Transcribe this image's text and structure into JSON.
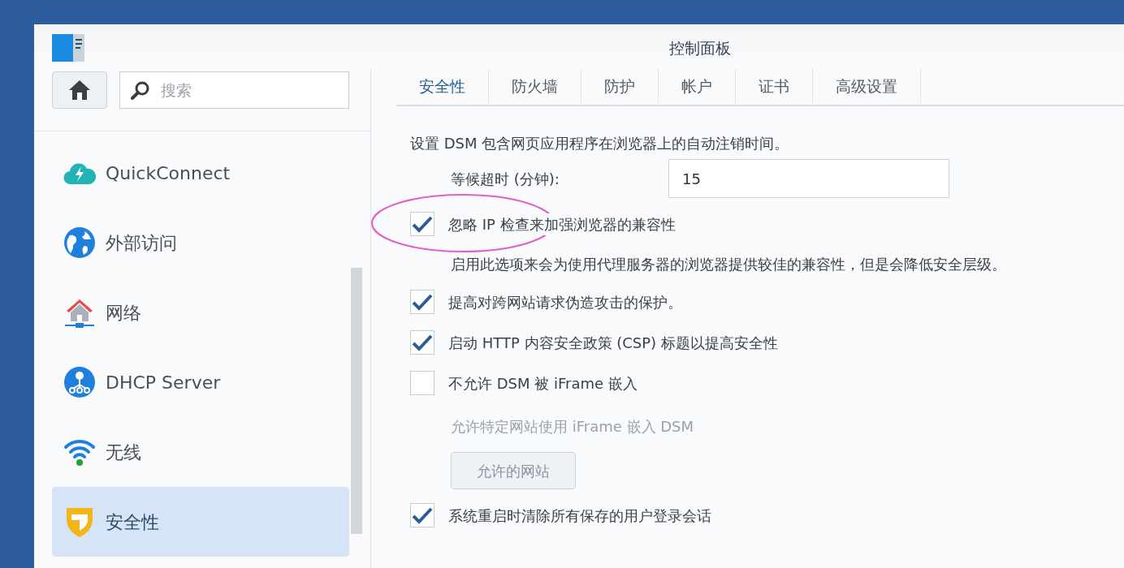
{
  "window": {
    "title": "控制面板"
  },
  "sidebar": {
    "search": {
      "placeholder": "搜索"
    },
    "items": [
      {
        "label": "QuickConnect",
        "selected": false
      },
      {
        "label": "外部访问",
        "selected": false
      },
      {
        "label": "网络",
        "selected": false
      },
      {
        "label": "DHCP Server",
        "selected": false
      },
      {
        "label": "无线",
        "selected": false
      },
      {
        "label": "安全性",
        "selected": true
      }
    ]
  },
  "tabs": [
    {
      "label": "安全性",
      "selected": true
    },
    {
      "label": "防火墙",
      "selected": false
    },
    {
      "label": "防护",
      "selected": false
    },
    {
      "label": "帐户",
      "selected": false
    },
    {
      "label": "证书",
      "selected": false
    },
    {
      "label": "高级设置",
      "selected": false
    }
  ],
  "content": [
    {
      "kind": "text",
      "text": "设置 DSM 包含网页应用程序在浏览器上的自动注销时间。"
    },
    {
      "kind": "field",
      "label": "等候超时 (分钟):",
      "value": "15"
    },
    {
      "kind": "checkbox",
      "label": "忽略 IP 检查来加强浏览器的兼容性",
      "checked": true,
      "highlighted": true
    },
    {
      "kind": "note",
      "text": "启用此选项来会为使用代理服务器的浏览器提供较佳的兼容性，但是会降低安全层级。"
    },
    {
      "kind": "checkbox",
      "label": "提高对跨网站请求伪造攻击的保护。",
      "checked": true,
      "highlighted": false
    },
    {
      "kind": "checkbox",
      "label": "启动 HTTP 内容安全政策 (CSP) 标题以提高安全性",
      "checked": true,
      "highlighted": false
    },
    {
      "kind": "checkbox",
      "label": "不允许 DSM 被 iFrame 嵌入",
      "checked": false,
      "highlighted": false
    },
    {
      "kind": "note",
      "text": "允许特定网站使用 iFrame 嵌入 DSM",
      "disabled": true
    },
    {
      "kind": "button",
      "label": "允许的网站"
    },
    {
      "kind": "checkbox",
      "label": "系统重启时清除所有保存的用户登录会话",
      "checked": true,
      "highlighted": false
    }
  ]
}
